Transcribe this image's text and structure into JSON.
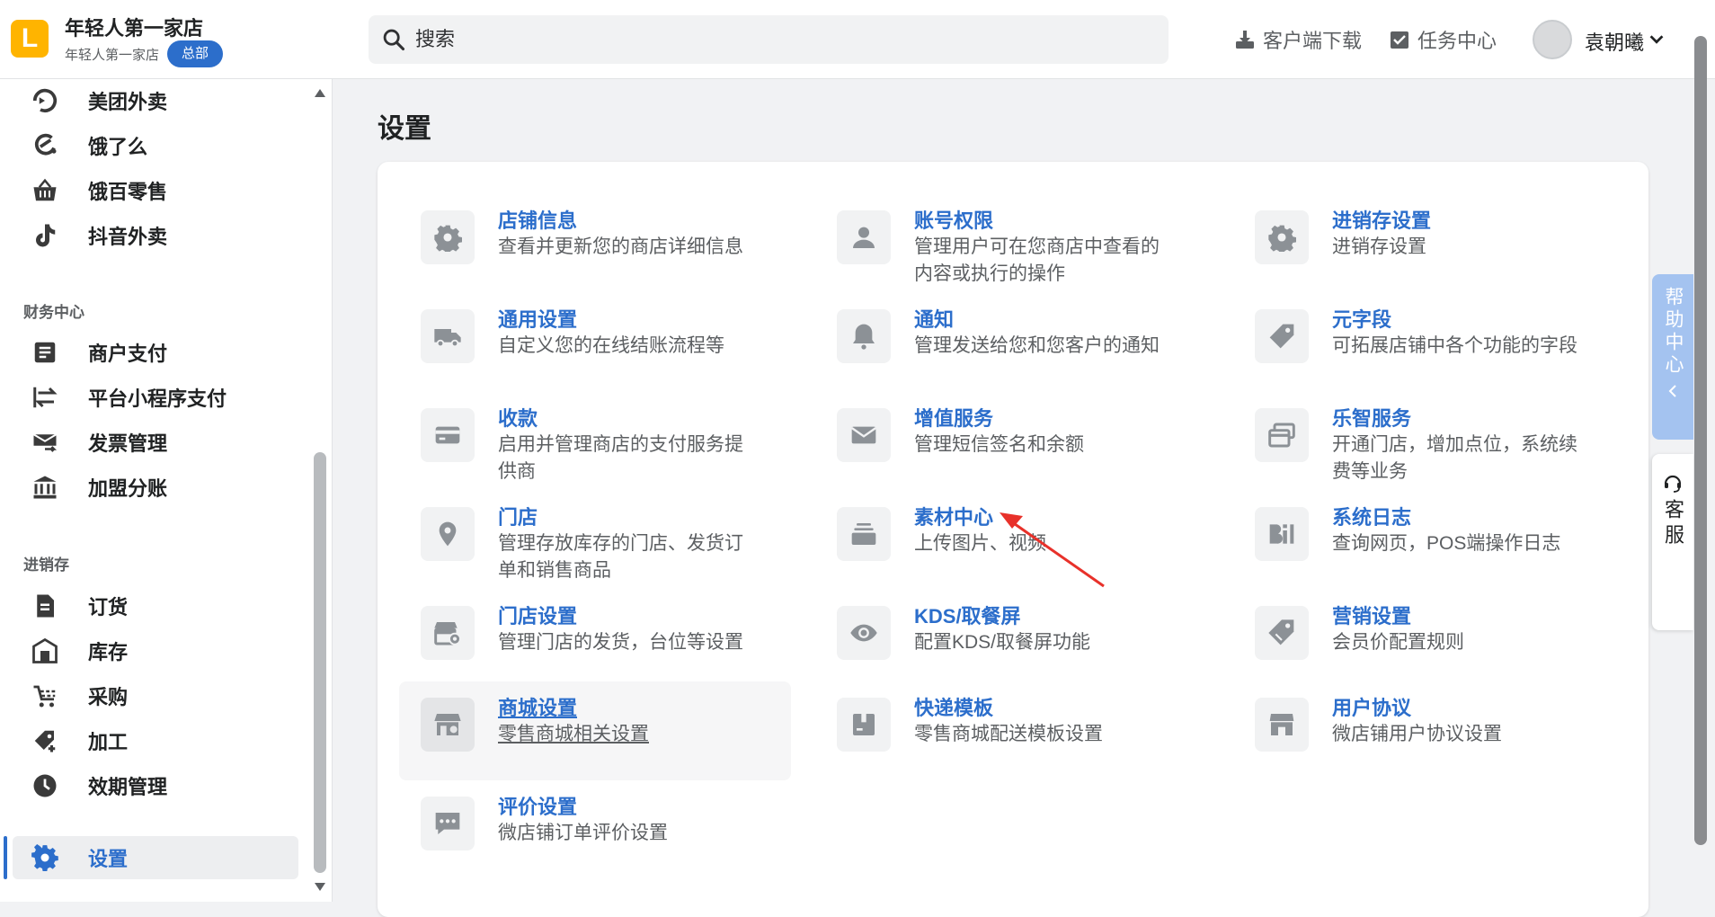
{
  "header": {
    "store_name": "年轻人第一家店",
    "store_sub": "年轻人第一家店",
    "badge": "总部",
    "search_placeholder": "搜索",
    "download_label": "客户端下载",
    "tasks_label": "任务中心",
    "user_name": "袁朝曦"
  },
  "sidebar": {
    "items_top": [
      {
        "label": "美团外卖",
        "icon": "meituan-icon"
      },
      {
        "label": "饿了么",
        "icon": "eleme-icon"
      },
      {
        "label": "饿百零售",
        "icon": "basket-icon"
      },
      {
        "label": "抖音外卖",
        "icon": "tiktok-icon"
      }
    ],
    "finance_title": "财务中心",
    "finance_items": [
      {
        "label": "商户支付",
        "icon": "document-icon"
      },
      {
        "label": "平台小程序支付",
        "icon": "transfer-icon"
      },
      {
        "label": "发票管理",
        "icon": "invoice-icon"
      },
      {
        "label": "加盟分账",
        "icon": "bank-icon"
      }
    ],
    "inventory_title": "进销存",
    "inventory_items": [
      {
        "label": "订货",
        "icon": "order-icon"
      },
      {
        "label": "库存",
        "icon": "warehouse-icon"
      },
      {
        "label": "采购",
        "icon": "purchase-icon"
      },
      {
        "label": "加工",
        "icon": "process-icon"
      },
      {
        "label": "效期管理",
        "icon": "clock-icon"
      }
    ],
    "settings_label": "设置"
  },
  "main": {
    "title": "设置",
    "tiles": [
      {
        "title": "店铺信息",
        "desc": "查看并更新您的商店详细信息",
        "icon": "gear-icon"
      },
      {
        "title": "账号权限",
        "desc": "管理用户可在您商店中查看的内容或执行的操作",
        "icon": "user-icon"
      },
      {
        "title": "进销存设置",
        "desc": "进销存设置",
        "icon": "gear-icon"
      },
      {
        "title": "通用设置",
        "desc": "自定义您的在线结账流程等",
        "icon": "truck-icon"
      },
      {
        "title": "通知",
        "desc": "管理发送给您和您客户的通知",
        "icon": "bell-icon"
      },
      {
        "title": "元字段",
        "desc": "可拓展店铺中各个功能的字段",
        "icon": "tag-icon"
      },
      {
        "title": "收款",
        "desc": "启用并管理商店的支付服务提供商",
        "icon": "card-icon"
      },
      {
        "title": "增值服务",
        "desc": "管理短信签名和余额",
        "icon": "mail-icon"
      },
      {
        "title": "乐智服务",
        "desc": "开通门店，增加点位，系统续费等业务",
        "icon": "cards-icon"
      },
      {
        "title": "门店",
        "desc": "管理存放库存的门店、发货订单和销售商品",
        "icon": "location-icon"
      },
      {
        "title": "素材中心",
        "desc": "上传图片、视频",
        "icon": "stack-icon"
      },
      {
        "title": "系统日志",
        "desc": "查询网页，POS端操作日志",
        "icon": "log-icon"
      },
      {
        "title": "门店设置",
        "desc": "管理门店的发货，台位等设置",
        "icon": "store-settings-icon"
      },
      {
        "title": "KDS/取餐屏",
        "desc": "配置KDS/取餐屏功能",
        "icon": "eye-icon"
      },
      {
        "title": "营销设置",
        "desc": "会员价配置规则",
        "icon": "marketing-tag-icon"
      },
      {
        "title": "商城设置",
        "desc": "零售商城相关设置",
        "icon": "shop-icon"
      },
      {
        "title": "快递模板",
        "desc": "零售商城配送模板设置",
        "icon": "package-icon"
      },
      {
        "title": "用户协议",
        "desc": "微店铺用户协议设置",
        "icon": "storefront-icon"
      },
      {
        "title": "评价设置",
        "desc": "微店铺订单评价设置",
        "icon": "comment-icon"
      }
    ]
  },
  "help": {
    "help_center": "帮助中心",
    "support": "客服"
  },
  "colors": {
    "accent": "#2c6ecb",
    "brand": "#ffb400"
  }
}
